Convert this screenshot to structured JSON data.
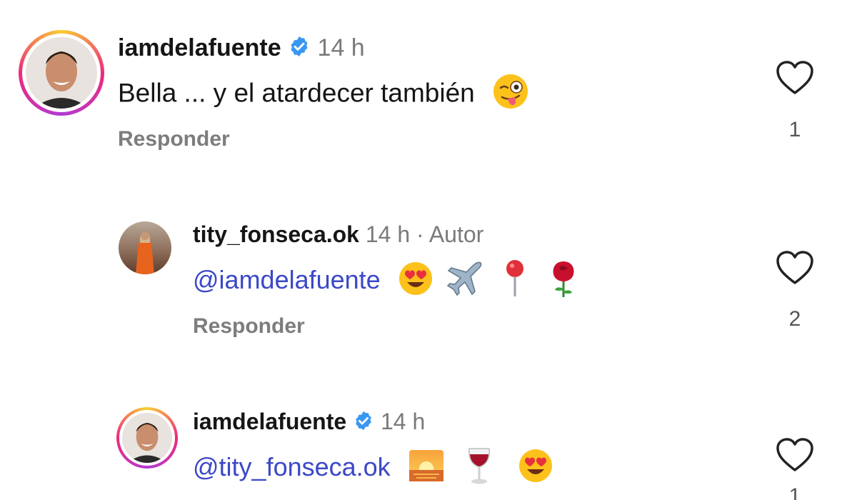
{
  "comments": [
    {
      "username": "iamdelafuente",
      "verified": true,
      "time": "14 h",
      "author_tag": "",
      "mention": "",
      "text": "Bella ... y el atardecer también",
      "emojis": [
        "winking-face-with-tongue"
      ],
      "reply_label": "Responder",
      "likes": "1"
    },
    {
      "username": "tity_fonseca.ok",
      "verified": false,
      "time": "14 h",
      "author_tag": "· Autor",
      "mention": "@iamdelafuente",
      "text": "",
      "emojis": [
        "heart-eyes",
        "airplane",
        "round-pushpin",
        "rose"
      ],
      "reply_label": "Responder",
      "likes": "2"
    },
    {
      "username": "iamdelafuente",
      "verified": true,
      "time": "14 h",
      "author_tag": "",
      "mention": "@tity_fonseca.ok",
      "text": "",
      "emojis": [
        "sunrise",
        "wine-glass",
        "heart-eyes"
      ],
      "reply_label": "",
      "likes": "1"
    }
  ],
  "colors": {
    "mention": "#3b48c7",
    "verified": "#3897f0",
    "muted": "#7d7d7d"
  }
}
